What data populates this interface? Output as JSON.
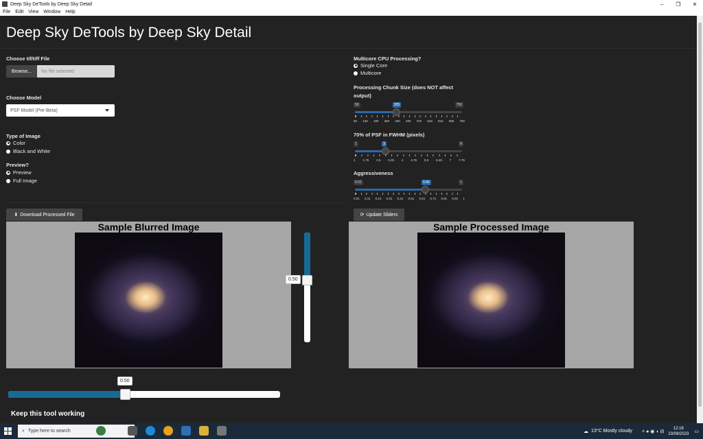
{
  "window": {
    "title": "Deep Sky DeTools by Deep Sky Detail",
    "controls": [
      "–",
      "❐",
      "✕"
    ]
  },
  "menu": [
    "File",
    "Edit",
    "View",
    "Window",
    "Help"
  ],
  "app": {
    "title": "Deep Sky DeTools by Deep Sky Detail",
    "file": {
      "label": "Choose tif/tiff File",
      "browse_label": "Browse...",
      "placeholder": "No file selected"
    },
    "model": {
      "label": "Choose Model",
      "selected": "PSF Model (Pre-Beta)"
    },
    "image_type": {
      "label": "Type of Image",
      "options": [
        "Color",
        "Black and White"
      ],
      "selected": "Color"
    },
    "preview": {
      "label": "Preview?",
      "options": [
        "Preview",
        "Full Image"
      ],
      "selected": "Preview"
    },
    "cpu": {
      "label": "Multicore CPU Processing?",
      "options": [
        "Single Core",
        "Multicore"
      ],
      "selected": "Single Core"
    },
    "chunk": {
      "label_line1": "Processing Chunk Size (does NOT affect",
      "label_line2": "output)",
      "min": "50",
      "max": "750",
      "value": "325",
      "fraction": 0.39,
      "ticks": [
        "50",
        "120",
        "190",
        "260",
        "330",
        "400",
        "470",
        "540",
        "610",
        "680",
        "750"
      ]
    },
    "psf": {
      "label": "70% of PSF in FWHM (pixels)",
      "min": "1",
      "max": "8",
      "value": "3",
      "fraction": 0.29,
      "ticks": [
        "1",
        "1.75",
        "2.5",
        "3.25",
        "4",
        "4.75",
        "5.5",
        "6.25",
        "7",
        "7.75"
      ]
    },
    "aggr": {
      "label": "Aggressiveness",
      "min": "0.01",
      "max": "1",
      "value": "0.66",
      "fraction": 0.66,
      "ticks": [
        "0.01",
        "0.11",
        "0.21",
        "0.31",
        "0.41",
        "0.51",
        "0.61",
        "0.71",
        "0.81",
        "0.91",
        "1"
      ]
    },
    "download_label": "Download Processed File",
    "update_label": "Update Sliders",
    "blurred_title": "Sample Blurred Image",
    "processed_title": "Sample Processed Image",
    "vslider_value": "0.50",
    "hslider_value": "0.50",
    "keep_title": "Keep this tool working"
  },
  "taskbar": {
    "search_placeholder": "Type here to search",
    "weather": "13°C  Mostly cloudy",
    "time": "12:16",
    "date": "23/09/2023"
  }
}
